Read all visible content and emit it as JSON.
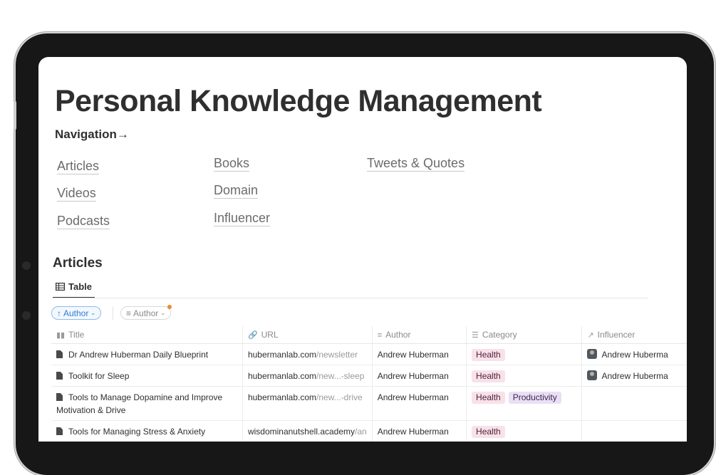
{
  "page": {
    "title": "Personal Knowledge Management",
    "nav_heading": "Navigation→"
  },
  "nav_links": [
    {
      "label": "Articles"
    },
    {
      "label": "Videos"
    },
    {
      "label": "Podcasts"
    },
    {
      "label": "Books"
    },
    {
      "label": "Domain"
    },
    {
      "label": "Influencer"
    },
    {
      "label": "Tweets & Quotes"
    }
  ],
  "articles": {
    "section_title": "Articles",
    "view_tab": {
      "label": "Table",
      "icon": "table-icon"
    },
    "sort_chip": {
      "label": "Author",
      "arrow": "↑",
      "icon": "sort-arrow-up-icon"
    },
    "filter_chip": {
      "label": "Author",
      "icon": "filter-lines-icon",
      "indicator_color": "#f0892e"
    },
    "columns": [
      {
        "label": "Title",
        "icon": "title-icon",
        "glyph": "▮▮"
      },
      {
        "label": "URL",
        "icon": "link-icon",
        "glyph": "🔗"
      },
      {
        "label": "Author",
        "icon": "text-lines-icon",
        "glyph": "≡"
      },
      {
        "label": "Category",
        "icon": "list-icon",
        "glyph": "☰"
      },
      {
        "label": "Influencer",
        "icon": "relation-arrow-icon",
        "glyph": "↗"
      }
    ],
    "rows": [
      {
        "title": "Dr Andrew Huberman Daily Blueprint",
        "url_domain": "hubermanlab.com",
        "url_rest": "/newsletter",
        "author": "Andrew Huberman",
        "tags": [
          "Health"
        ],
        "influencer": "Andrew Huberma"
      },
      {
        "title": "Toolkit for Sleep",
        "url_domain": "hubermanlab.com",
        "url_rest": "/new...-sleep",
        "author": "Andrew Huberman",
        "tags": [
          "Health"
        ],
        "influencer": "Andrew Huberma"
      },
      {
        "title": "Tools to Manage Dopamine and Improve Motivation & Drive",
        "url_domain": "hubermanlab.com",
        "url_rest": "/new...-drive",
        "author": "Andrew Huberman",
        "tags": [
          "Health",
          "Productivity"
        ],
        "influencer": ""
      },
      {
        "title": "Tools for Managing Stress & Anxiety",
        "url_domain": "wisdominanutshell.academy",
        "url_rest": "/an",
        "author": "Andrew Huberman",
        "tags": [
          "Health"
        ],
        "influencer": ""
      }
    ],
    "tag_colors": {
      "Health": {
        "bg": "#f9e1ea",
        "fg": "#4c2337"
      },
      "Productivity": {
        "bg": "#e9e0f4",
        "fg": "#412454"
      }
    }
  }
}
